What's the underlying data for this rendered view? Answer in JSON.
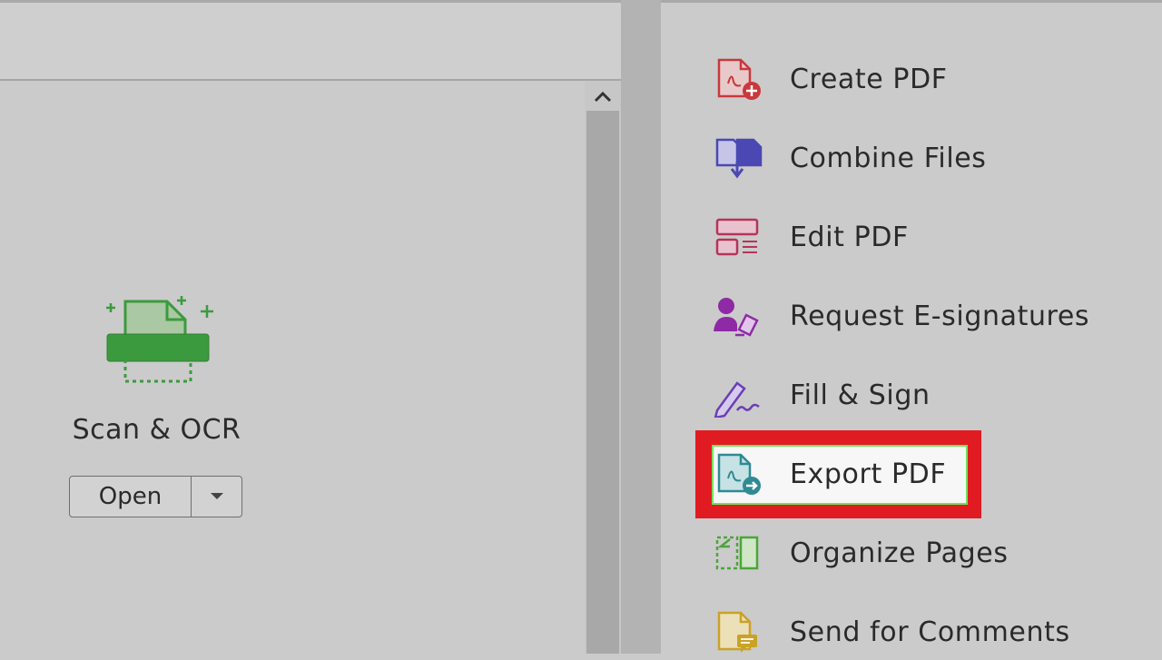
{
  "scan": {
    "label": "Scan & OCR",
    "open_label": "Open",
    "icon": "scanner-icon",
    "color": "#3c9a3e"
  },
  "tools": [
    {
      "label": "Create PDF",
      "icon": "create-pdf-icon",
      "color": "#c8383c"
    },
    {
      "label": "Combine Files",
      "icon": "combine-files-icon",
      "color": "#4b48b3"
    },
    {
      "label": "Edit PDF",
      "icon": "edit-pdf-icon",
      "color": "#b5345a"
    },
    {
      "label": "Request E-signatures",
      "icon": "request-esignatures-icon",
      "color": "#8e2aa6"
    },
    {
      "label": "Fill & Sign",
      "icon": "fill-sign-icon",
      "color": "#6a3fb5"
    },
    {
      "label": "Export PDF",
      "icon": "export-pdf-icon",
      "color": "#2f8a93",
      "highlighted": true
    },
    {
      "label": "Organize Pages",
      "icon": "organize-pages-icon",
      "color": "#4ea43c"
    },
    {
      "label": "Send for Comments",
      "icon": "send-for-comments-icon",
      "color": "#c9a227"
    }
  ],
  "highlight_color": "#e11b22"
}
